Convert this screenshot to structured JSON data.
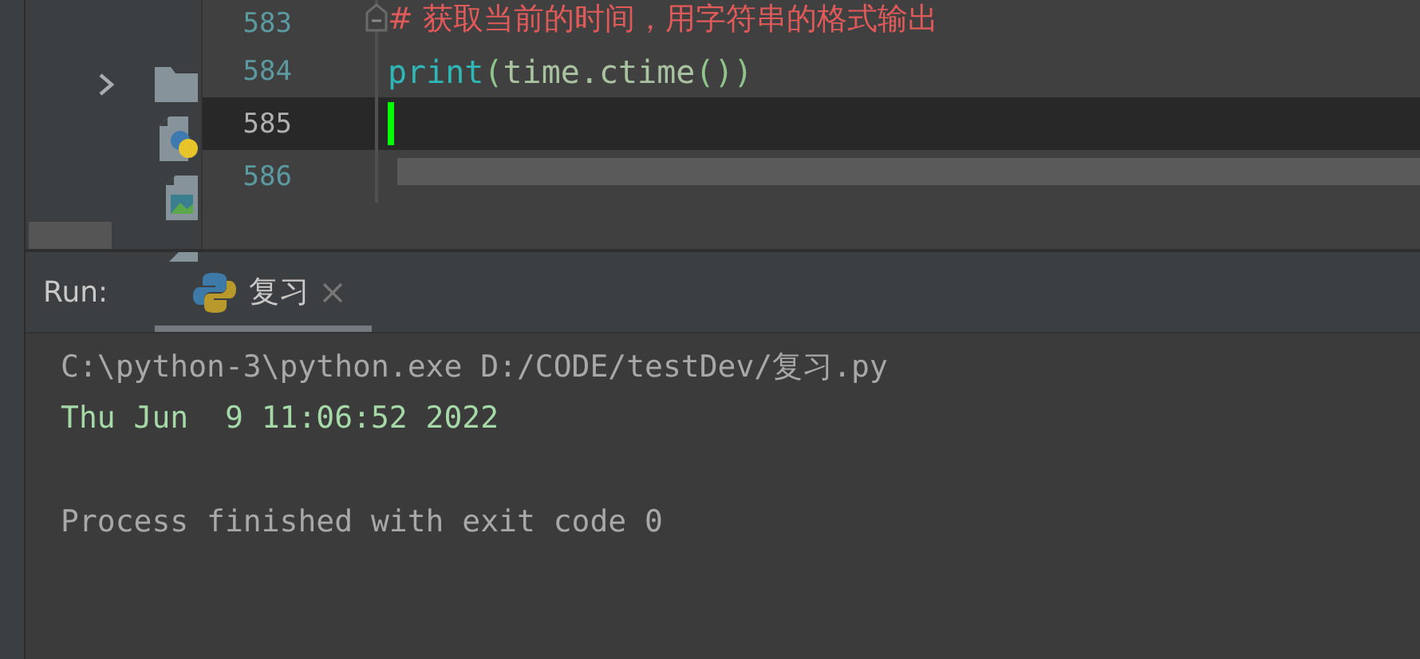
{
  "project_tree": {
    "items": [
      {
        "kind": "folder",
        "expanded": false
      },
      {
        "kind": "python"
      },
      {
        "kind": "image"
      },
      {
        "kind": "file"
      }
    ]
  },
  "editor": {
    "lines": [
      {
        "number": "583",
        "current": false,
        "foldable": true,
        "tokens": [
          {
            "kind": "comment",
            "text": "# 获取当前的时间，用字符串的格式输出"
          }
        ]
      },
      {
        "number": "584",
        "current": false,
        "foldable": false,
        "tokens": [
          {
            "kind": "builtin",
            "text": "print"
          },
          {
            "kind": "paren",
            "text": "("
          },
          {
            "kind": "name",
            "text": "time.ctime"
          },
          {
            "kind": "paren",
            "text": "())"
          }
        ]
      },
      {
        "number": "585",
        "current": true,
        "foldable": false
      },
      {
        "number": "586",
        "current": false,
        "foldable": false
      }
    ]
  },
  "run_panel": {
    "label": "Run:",
    "tabs": [
      {
        "label": "复习",
        "selected": true
      }
    ],
    "output": [
      {
        "kind": "command",
        "text": "C:\\python-3\\python.exe D:/CODE/testDev/复习.py"
      },
      {
        "kind": "stdout",
        "text": "Thu Jun  9 11:06:52 2022"
      },
      {
        "kind": "exit",
        "text": "Process finished with exit code 0"
      }
    ]
  }
}
